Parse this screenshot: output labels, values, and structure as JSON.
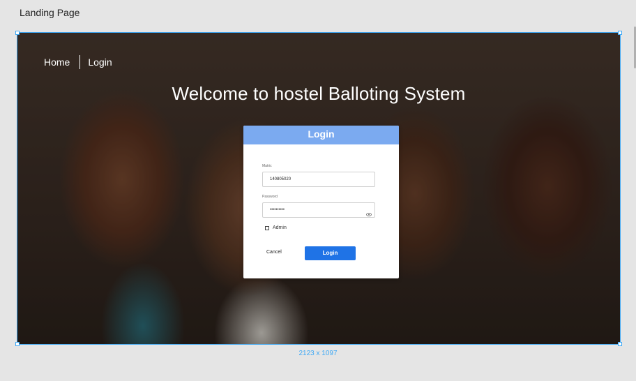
{
  "frame": {
    "title": "Landing Page",
    "dimensions": "2123 x 1097"
  },
  "nav": {
    "home": "Home",
    "login": "Login"
  },
  "hero": {
    "title": "Welcome to hostel Balloting System"
  },
  "login_card": {
    "header": "Login",
    "matric_label": "Matric",
    "matric_value": "140805020",
    "password_label": "Password",
    "password_value": "••••••••••",
    "admin_label": "Admin",
    "cancel_label": "Cancel",
    "login_label": "Login"
  },
  "colors": {
    "selection": "#3fa9f5",
    "card_header": "#7baaf0",
    "primary_button": "#1f73e6"
  }
}
